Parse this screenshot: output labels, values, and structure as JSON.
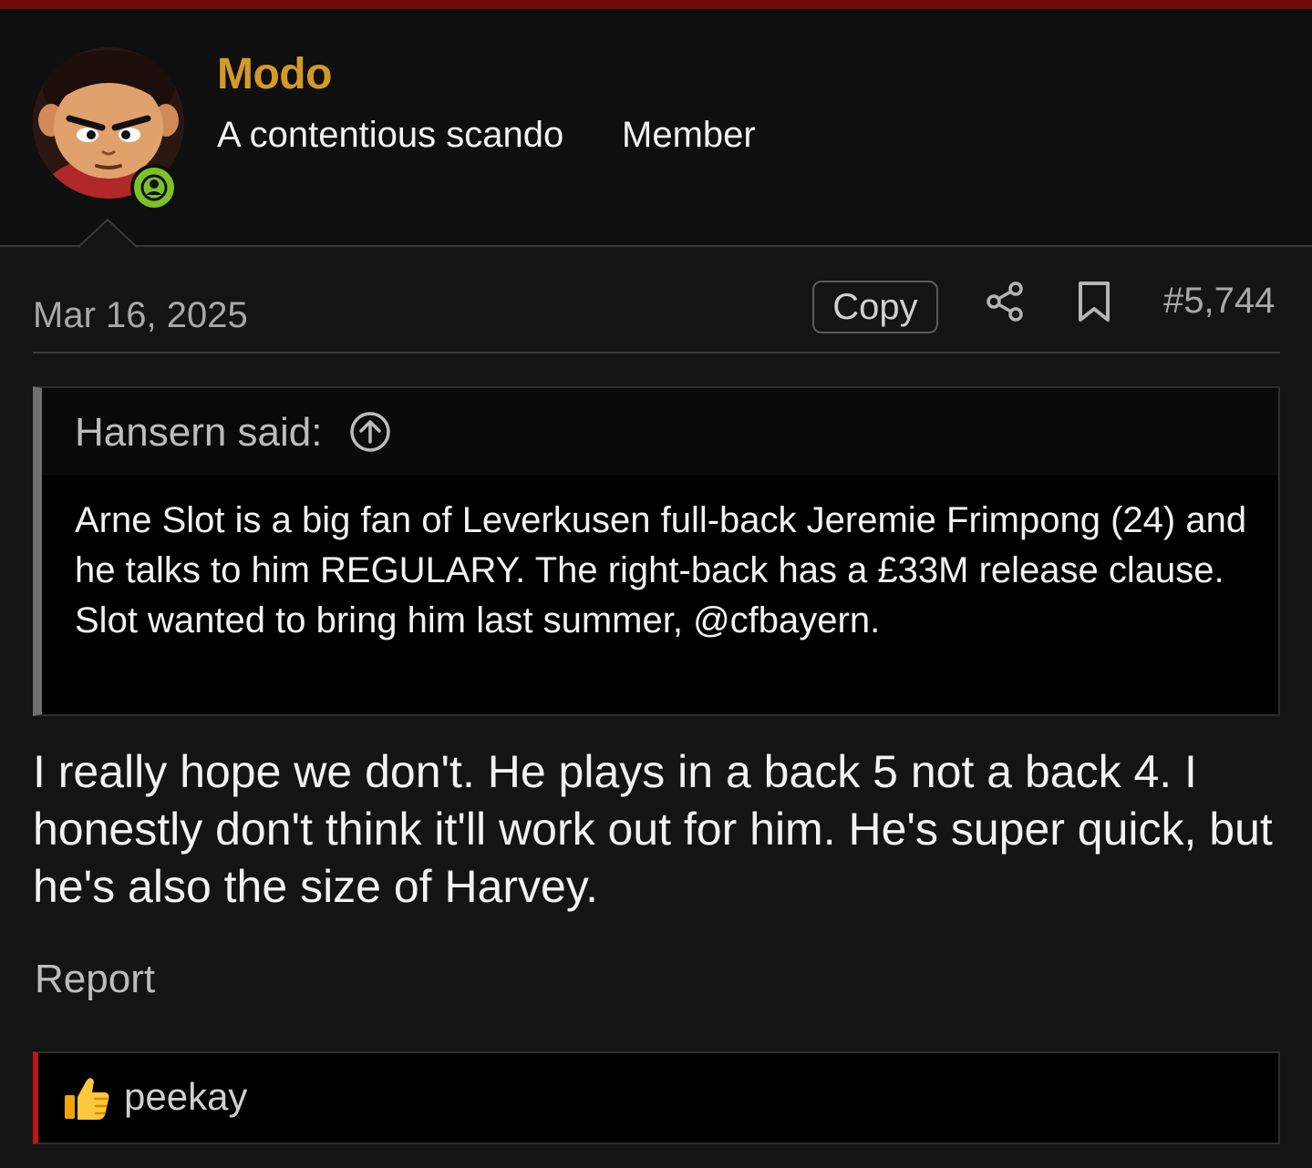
{
  "colors": {
    "topbar": "#6e0a0a",
    "username": "#d49a28",
    "online": "#7cc127",
    "reaction_accent": "#c0151a"
  },
  "user": {
    "name": "Modo",
    "title": "A contentious scando",
    "rank": "Member",
    "avatar_icon": "cartoon-avatar",
    "status_icon": "online-user-icon"
  },
  "post": {
    "date": "Mar 16, 2025",
    "copy_label": "Copy",
    "share_icon": "share-icon",
    "bookmark_icon": "bookmark-icon",
    "number": "#5,744",
    "quote": {
      "author": "Hansern said:",
      "jump_icon": "arrow-up-circle-icon",
      "text": "Arne Slot is a big fan of Leverkusen full-back Jeremie Frimpong (24) and he talks to him REGULARY. The right-back has a £33M release clause. Slot wanted to bring him last summer, @cfbayern."
    },
    "body": "I really hope we don't. He plays in a back 5 not a back 4. I honestly don't think it'll work out for him. He's super quick, but he's also the size of Harvey.",
    "report_label": "Report",
    "reactions": {
      "icon": "thumbs-up-icon",
      "users": "peekay"
    }
  }
}
